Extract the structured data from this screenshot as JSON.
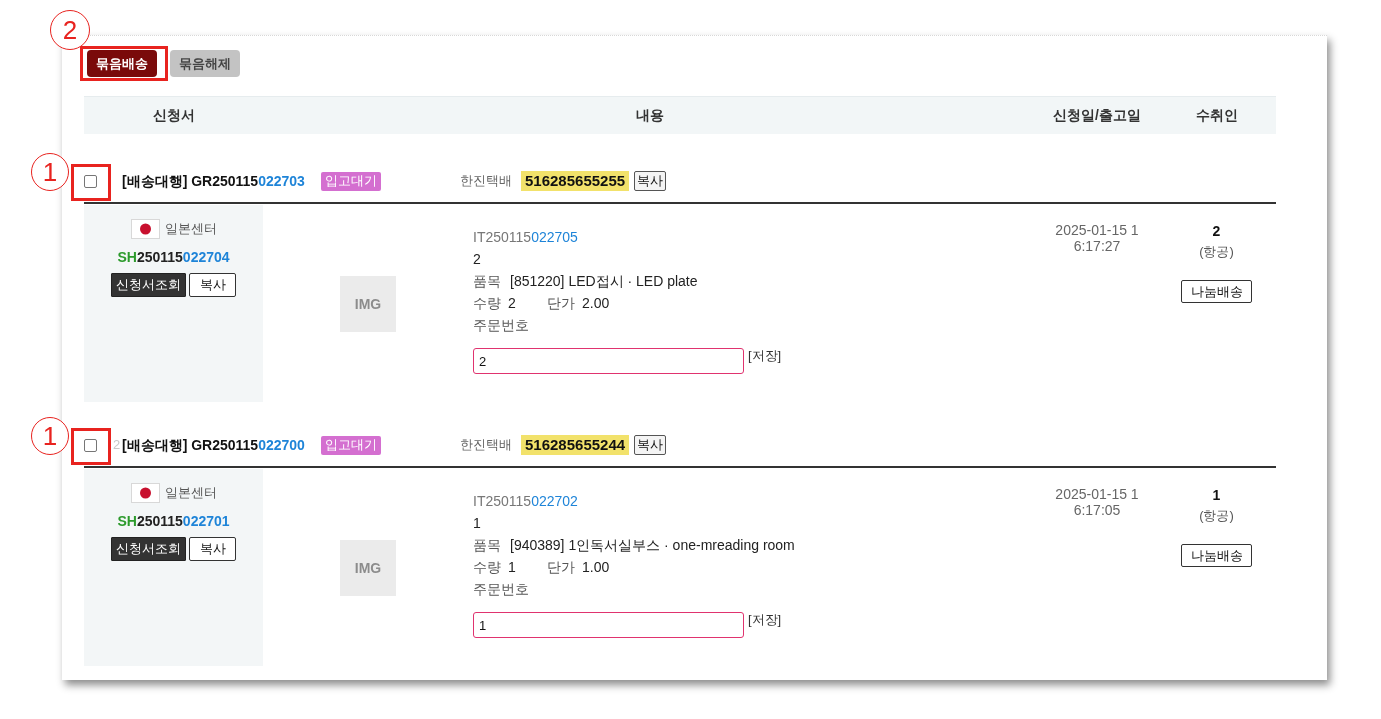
{
  "toolbar": {
    "buttons": [
      {
        "label": "묶음배송",
        "kind": "primary",
        "callout": "2"
      },
      {
        "label": "묶음해제",
        "kind": "secondary"
      }
    ]
  },
  "table": {
    "columns": [
      "신청서",
      "내용",
      "신청일/출고일",
      "수취인"
    ]
  },
  "orders": [
    {
      "checked": false,
      "callout": "1",
      "title": "[배송대행] GR250115",
      "title_tail": "022703",
      "status": "입고대기",
      "courier": "한진택배",
      "tracking": "516285655255",
      "tracking_copy": "복사",
      "center": "일본센터",
      "shipment": {
        "prefix": "SH",
        "middle": "250115",
        "tail": "022704"
      },
      "view_button": "신청서조회",
      "copy_button": "복사",
      "image_label": "IMG",
      "item_code": {
        "prefix": "IT250115",
        "tail": "022705"
      },
      "item_name": "2",
      "product_label": "품목",
      "product": "[851220] LED접시 · LED plate",
      "qty_label": "수량",
      "qty": "2",
      "price_label": "단가",
      "price": "2.00",
      "order_no_label": "주문번호",
      "order_no": "2",
      "save_label": "[저장]",
      "date": "2025-01-15 16:17:27",
      "recipient": "2",
      "method": "(항공)",
      "split_button": "나눔배송"
    },
    {
      "checked": false,
      "callout": "1",
      "row_number": "2",
      "title": "[배송대행] GR250115",
      "title_tail": "022700",
      "status": "입고대기",
      "courier": "한진택배",
      "tracking": "516285655244",
      "tracking_copy": "복사",
      "center": "일본센터",
      "shipment": {
        "prefix": "SH",
        "middle": "250115",
        "tail": "022701"
      },
      "view_button": "신청서조회",
      "copy_button": "복사",
      "image_label": "IMG",
      "item_code": {
        "prefix": "IT250115",
        "tail": "022702"
      },
      "item_name": "1",
      "product_label": "품목",
      "product": "[940389] 1인독서실부스 · one-mreading room",
      "qty_label": "수량",
      "qty": "1",
      "price_label": "단가",
      "price": "1.00",
      "order_no_label": "주문번호",
      "order_no": "1",
      "save_label": "[저장]",
      "date": "2025-01-15 16:17:05",
      "recipient": "1",
      "method": "(항공)",
      "split_button": "나눔배송"
    }
  ]
}
